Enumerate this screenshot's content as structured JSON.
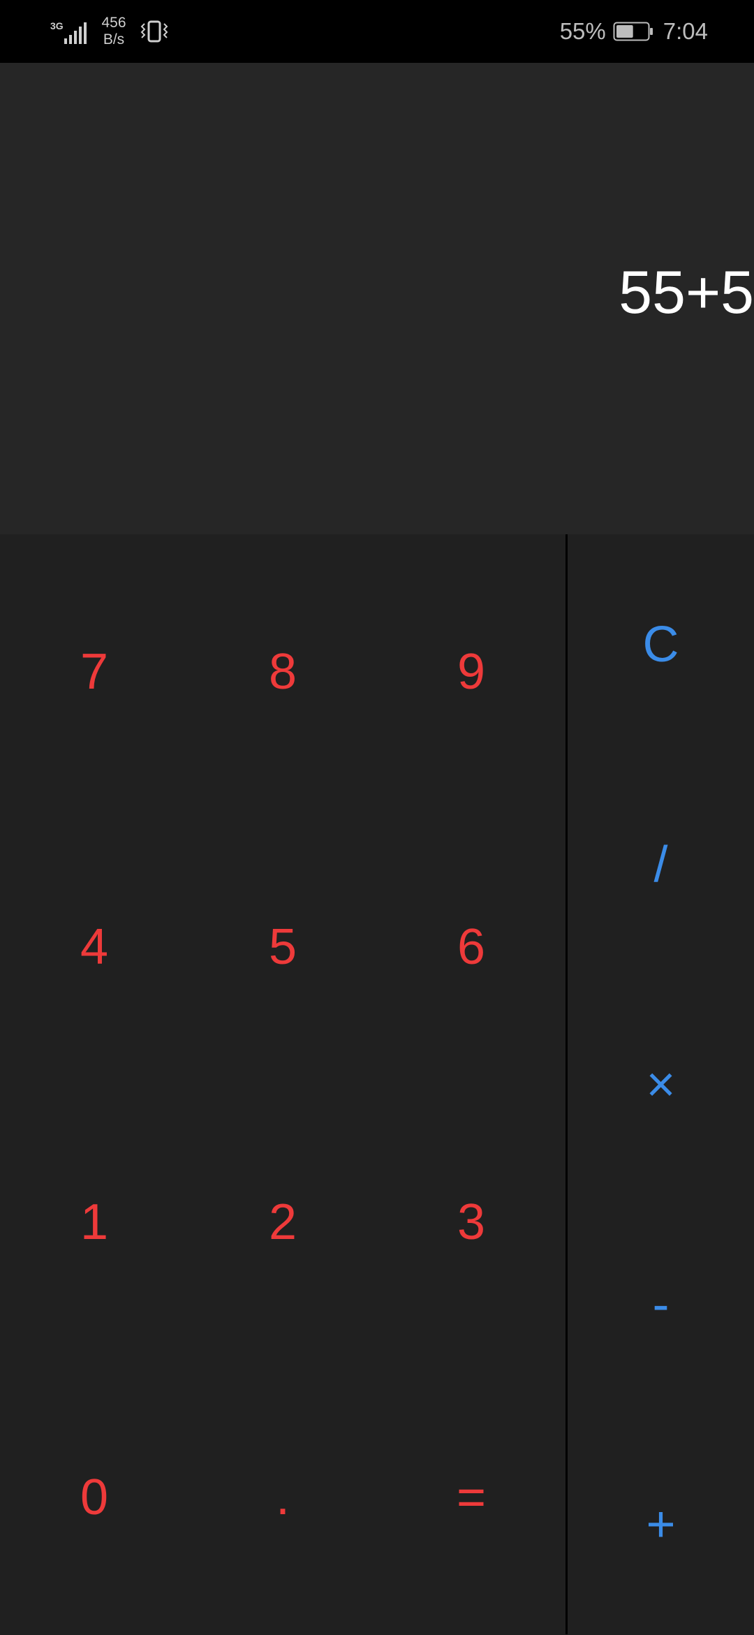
{
  "status_bar": {
    "network_type": "3G",
    "net_speed_value": "456",
    "net_speed_unit": "B/s",
    "battery_percent": "55%",
    "battery_level": 0.55,
    "time": "7:04",
    "icons": [
      "signal-icon",
      "vibrate-icon",
      "battery-icon"
    ]
  },
  "display": {
    "expression": "55+5"
  },
  "keypad": {
    "digits": [
      [
        "7",
        "8",
        "9"
      ],
      [
        "4",
        "5",
        "6"
      ],
      [
        "1",
        "2",
        "3"
      ],
      [
        "0",
        ".",
        "="
      ]
    ]
  },
  "operators": [
    "C",
    "/",
    "×",
    "-",
    "+"
  ],
  "colors": {
    "digit_key": "#ee3a3a",
    "operator_key": "#3b8ce8",
    "display_bg": "#262626",
    "keypad_bg": "#202020",
    "expression_text": "#ffffff"
  }
}
